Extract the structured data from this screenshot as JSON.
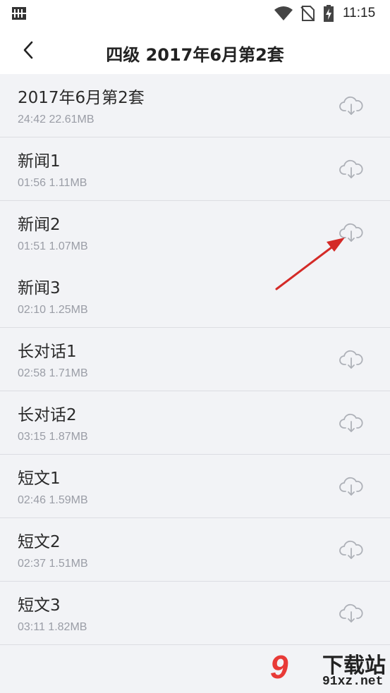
{
  "status_bar": {
    "time": "11:15",
    "icons": [
      "notification-grid-icon",
      "wifi-icon",
      "no-sim-icon",
      "battery-charging-icon"
    ]
  },
  "header": {
    "back_icon": "chevron-left-icon",
    "title": "四级 2017年6月第2套"
  },
  "items": [
    {
      "name": "2017年6月第2套",
      "meta": "24:42 22.61MB",
      "icon": "cloud-download-icon"
    },
    {
      "name": "新闻1",
      "meta": "01:56 1.11MB",
      "icon": "cloud-download-icon"
    },
    {
      "name": "新闻2",
      "meta": "01:51 1.07MB",
      "icon": "cloud-download-icon"
    },
    {
      "name": "新闻3",
      "meta": "02:10 1.25MB",
      "icon": null
    },
    {
      "name": "长对话1",
      "meta": "02:58 1.71MB",
      "icon": "cloud-download-icon"
    },
    {
      "name": "长对话2",
      "meta": "03:15 1.87MB",
      "icon": "cloud-download-icon"
    },
    {
      "name": "短文1",
      "meta": "02:46 1.59MB",
      "icon": "cloud-download-icon"
    },
    {
      "name": "短文2",
      "meta": "02:37 1.51MB",
      "icon": "cloud-download-icon"
    },
    {
      "name": "短文3",
      "meta": "03:11 1.82MB",
      "icon": "cloud-download-icon"
    }
  ],
  "annotation": {
    "icon": "red-arrow-icon",
    "color": "#d42a27"
  },
  "watermark": {
    "logo": "9",
    "title": "下载站",
    "url": "91xz.net",
    "brand_color": "#e83a37"
  }
}
